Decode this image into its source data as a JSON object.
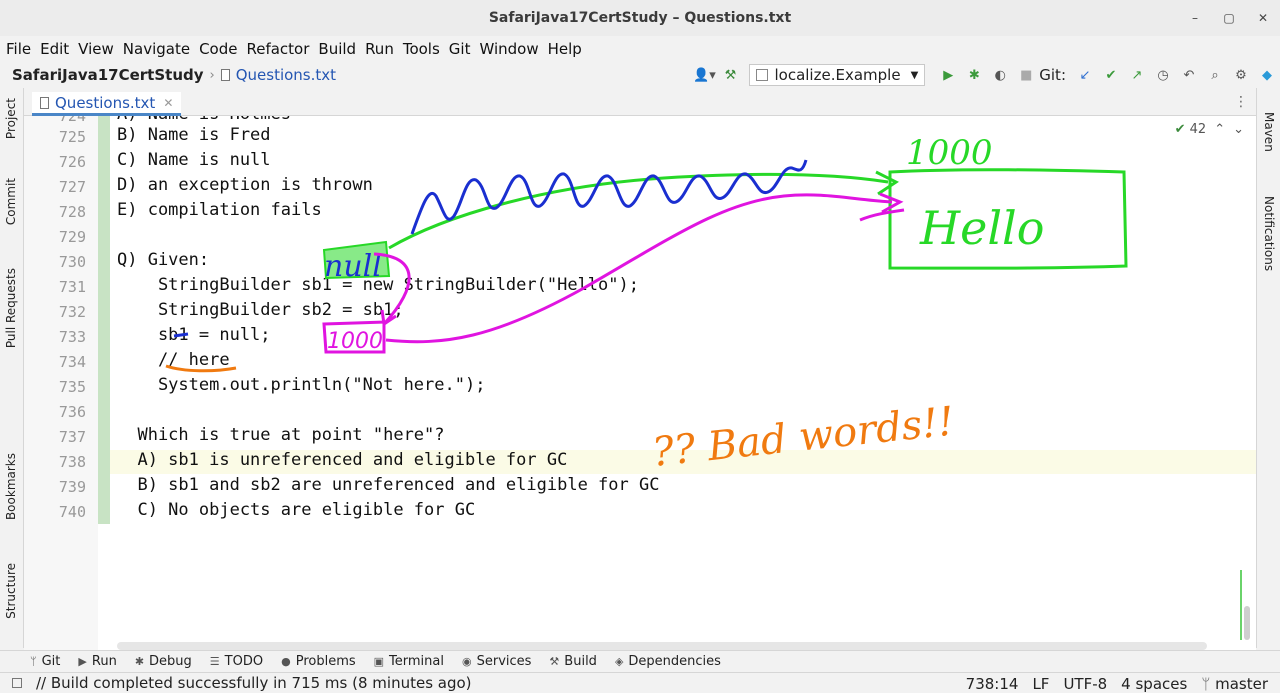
{
  "window": {
    "title": "SafariJava17CertStudy – Questions.txt",
    "controls": [
      "–",
      "▢",
      "✕"
    ]
  },
  "menu": [
    "File",
    "Edit",
    "View",
    "Navigate",
    "Code",
    "Refactor",
    "Build",
    "Run",
    "Tools",
    "Git",
    "Window",
    "Help"
  ],
  "nav": {
    "project": "SafariJava17CertStudy",
    "file": "Questions.txt",
    "run_config": "localize.Example",
    "git_label": "Git:"
  },
  "tab": {
    "label": "Questions.txt"
  },
  "inspection": {
    "count": "42"
  },
  "left_tools": [
    "Project",
    "Commit",
    "Pull Requests",
    "Bookmarks",
    "Structure"
  ],
  "right_tools": [
    "Maven",
    "Notifications"
  ],
  "editor": {
    "lines": [
      {
        "no": "724",
        "text": "A) Name is Holmes"
      },
      {
        "no": "725",
        "text": "B) Name is Fred"
      },
      {
        "no": "726",
        "text": "C) Name is null"
      },
      {
        "no": "727",
        "text": "D) an exception is thrown"
      },
      {
        "no": "728",
        "text": "E) compilation fails"
      },
      {
        "no": "729",
        "text": ""
      },
      {
        "no": "730",
        "text": "Q) Given:"
      },
      {
        "no": "731",
        "text": "    StringBuilder sb1 = new StringBuilder(\"Hello\");"
      },
      {
        "no": "732",
        "text": "    StringBuilder sb2 = sb1;"
      },
      {
        "no": "733",
        "text": "    sb1 = null;"
      },
      {
        "no": "734",
        "text": "    // here"
      },
      {
        "no": "735",
        "text": "    System.out.println(\"Not here.\");"
      },
      {
        "no": "736",
        "text": ""
      },
      {
        "no": "737",
        "text": "  Which is true at point \"here\"?"
      },
      {
        "no": "738",
        "text": "  A) sb1 is unreferenced and eligible for GC"
      },
      {
        "no": "739",
        "text": "  B) sb1 and sb2 are unreferenced and eligible for GC"
      },
      {
        "no": "740",
        "text": "  C) No objects are eligible for GC"
      }
    ]
  },
  "annotations": {
    "box_address": "1000",
    "box_content": "Hello",
    "ref_null": "null",
    "ref_address": "1000",
    "note": "?? Bad words!!"
  },
  "tool_windows": [
    {
      "icon": "git-icon",
      "glyph": "ᛘ",
      "label": "Git"
    },
    {
      "icon": "run-icon",
      "glyph": "▶",
      "label": "Run"
    },
    {
      "icon": "debug-icon",
      "glyph": "✱",
      "label": "Debug"
    },
    {
      "icon": "todo-icon",
      "glyph": "☰",
      "label": "TODO"
    },
    {
      "icon": "problems-icon",
      "glyph": "●",
      "label": "Problems"
    },
    {
      "icon": "terminal-icon",
      "glyph": "▣",
      "label": "Terminal"
    },
    {
      "icon": "services-icon",
      "glyph": "◉",
      "label": "Services"
    },
    {
      "icon": "build-icon",
      "glyph": "⚒",
      "label": "Build"
    },
    {
      "icon": "dependencies-icon",
      "glyph": "◈",
      "label": "Dependencies"
    }
  ],
  "status": {
    "message": "// Build completed successfully in 715 ms (8 minutes ago)",
    "position": "738:14",
    "line_sep": "LF",
    "encoding": "UTF-8",
    "indent": "4 spaces",
    "branch": "master"
  },
  "colors": {
    "ink_green": "#27d827",
    "ink_blue": "#1a2fd0",
    "ink_magenta": "#e014e0",
    "ink_orange": "#f07a10",
    "link_blue": "#2456b2"
  }
}
